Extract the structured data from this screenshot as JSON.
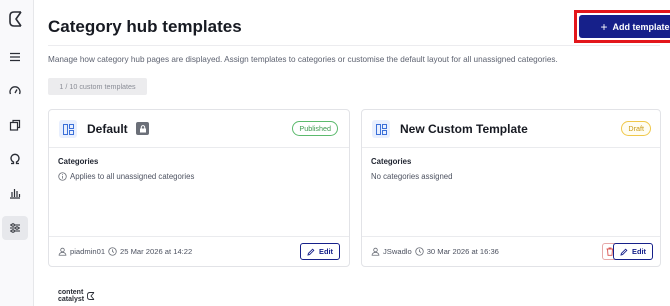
{
  "sidebar": {
    "items": [
      {
        "name": "menu-icon"
      },
      {
        "name": "speedometer-icon"
      },
      {
        "name": "copy-icon"
      },
      {
        "name": "omega-icon"
      },
      {
        "name": "bar-chart-icon"
      },
      {
        "name": "sliders-icon",
        "active": true
      }
    ]
  },
  "header": {
    "title": "Category hub templates",
    "add_button_label": "Add template",
    "subtitle": "Manage how category hub pages are displayed. Assign templates to categories or customise the default layout for all unassigned categories.",
    "template_count": "1 / 10 custom templates"
  },
  "cards": [
    {
      "title": "Default",
      "status": "Published",
      "locked": true,
      "categories_label": "Categories",
      "categories_value": "Applies to all unassigned categories",
      "author": "piadmin01",
      "timestamp": "25 Mar 2026 at 14:22",
      "edit_label": "Edit"
    },
    {
      "title": "New Custom Template",
      "status": "Draft",
      "locked": false,
      "categories_label": "Categories",
      "categories_value": "No categories assigned",
      "author": "JSwadlo",
      "timestamp": "30 Mar 2026 at 16:36",
      "edit_label": "Edit"
    }
  ],
  "footer": {
    "brand_line1": "content",
    "brand_line2": "catalyst"
  },
  "colors": {
    "primary": "#16208a",
    "highlight_border": "#e3161b",
    "published": "#3d9a4f",
    "draft": "#c99a12"
  }
}
